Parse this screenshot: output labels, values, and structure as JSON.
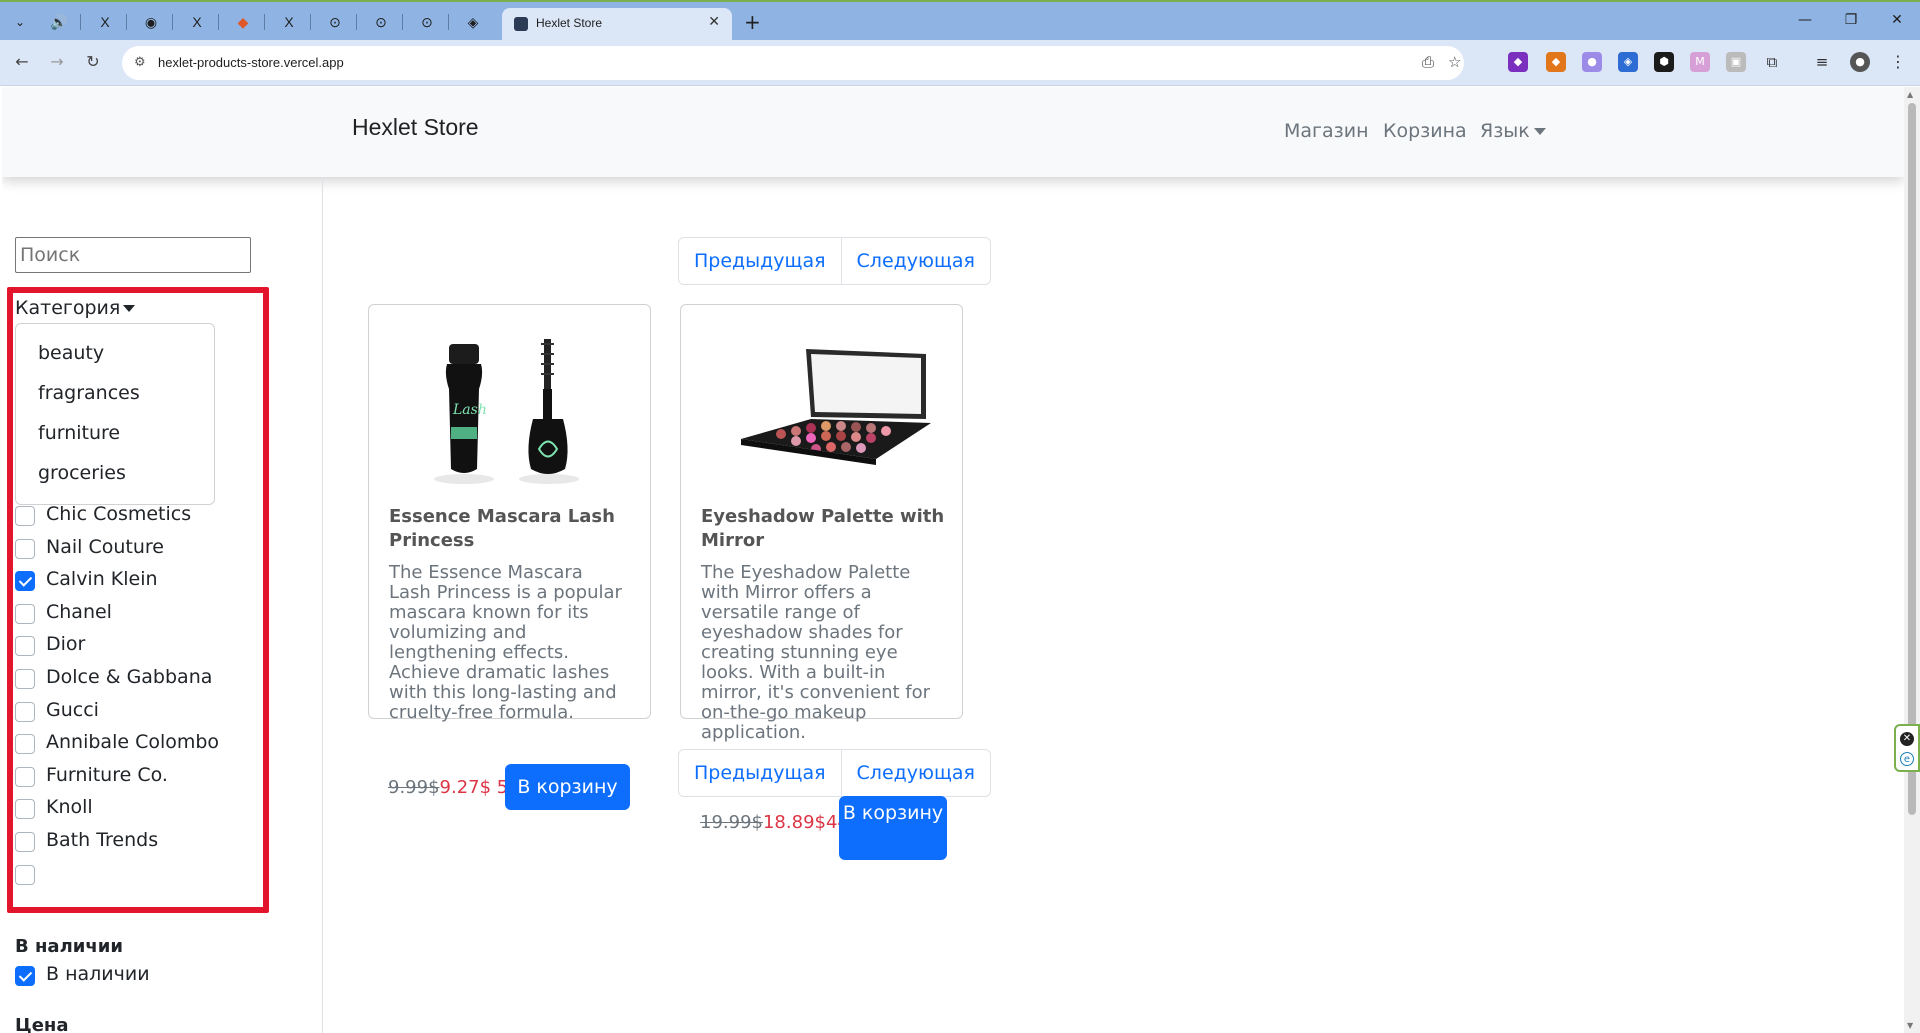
{
  "browser": {
    "tab_title": "Hexlet Store",
    "url": "hexlet-products-store.vercel.app",
    "pinned_tabs": [
      "🔊",
      "X",
      "◉",
      "X",
      "◆",
      "X",
      "⊙",
      "⊙",
      "⊙",
      "◈"
    ]
  },
  "navbar": {
    "brand": "Hexlet Store",
    "links": {
      "shop": "Магазин",
      "cart": "Корзина",
      "language": "Язык"
    }
  },
  "sidebar": {
    "search_placeholder": "Поиск",
    "category_toggle": "Категория",
    "category_options": [
      "beauty",
      "fragrances",
      "furniture",
      "groceries"
    ],
    "brands": [
      {
        "label": "Chic Cosmetics",
        "checked": false
      },
      {
        "label": "Nail Couture",
        "checked": false
      },
      {
        "label": "Calvin Klein",
        "checked": true
      },
      {
        "label": "Chanel",
        "checked": false
      },
      {
        "label": "Dior",
        "checked": false
      },
      {
        "label": "Dolce & Gabbana",
        "checked": false
      },
      {
        "label": "Gucci",
        "checked": false
      },
      {
        "label": "Annibale Colombo",
        "checked": false
      },
      {
        "label": "Furniture Co.",
        "checked": false
      },
      {
        "label": "Knoll",
        "checked": false
      },
      {
        "label": "Bath Trends",
        "checked": false
      },
      {
        "label": "",
        "checked": false
      }
    ],
    "availability_title": "В наличии",
    "availability_option": {
      "label": "В наличии",
      "checked": true
    },
    "price_title": "Цена"
  },
  "pagination": {
    "prev": "Предыдущая",
    "next": "Следующая"
  },
  "products": [
    {
      "title": "Essence Mascara Lash Princess",
      "description": "The Essence Mascara Lash Princess is a popular mascara known for its volumizing and lengthening effects. Achieve dramatic lashes with this long-lasting and cruelty-free formula.",
      "old_price": "9.99$",
      "new_price": "9.27$",
      "extra": "5",
      "button": "В корзину"
    },
    {
      "title": "Eyeshadow Palette with Mirror",
      "description": "The Eyeshadow Palette with Mirror offers a versatile range of eyeshadow shades for creating stunning eye looks. With a built-in mirror, it's convenient for on-the-go makeup application.",
      "old_price": "19.99$",
      "new_price": "18.89$",
      "extra": "44",
      "button": "В корзину"
    }
  ],
  "colors": {
    "primary": "#0d6efd",
    "danger": "#dc3545",
    "highlight_box": "#e3152c",
    "muted": "#6c757d"
  }
}
